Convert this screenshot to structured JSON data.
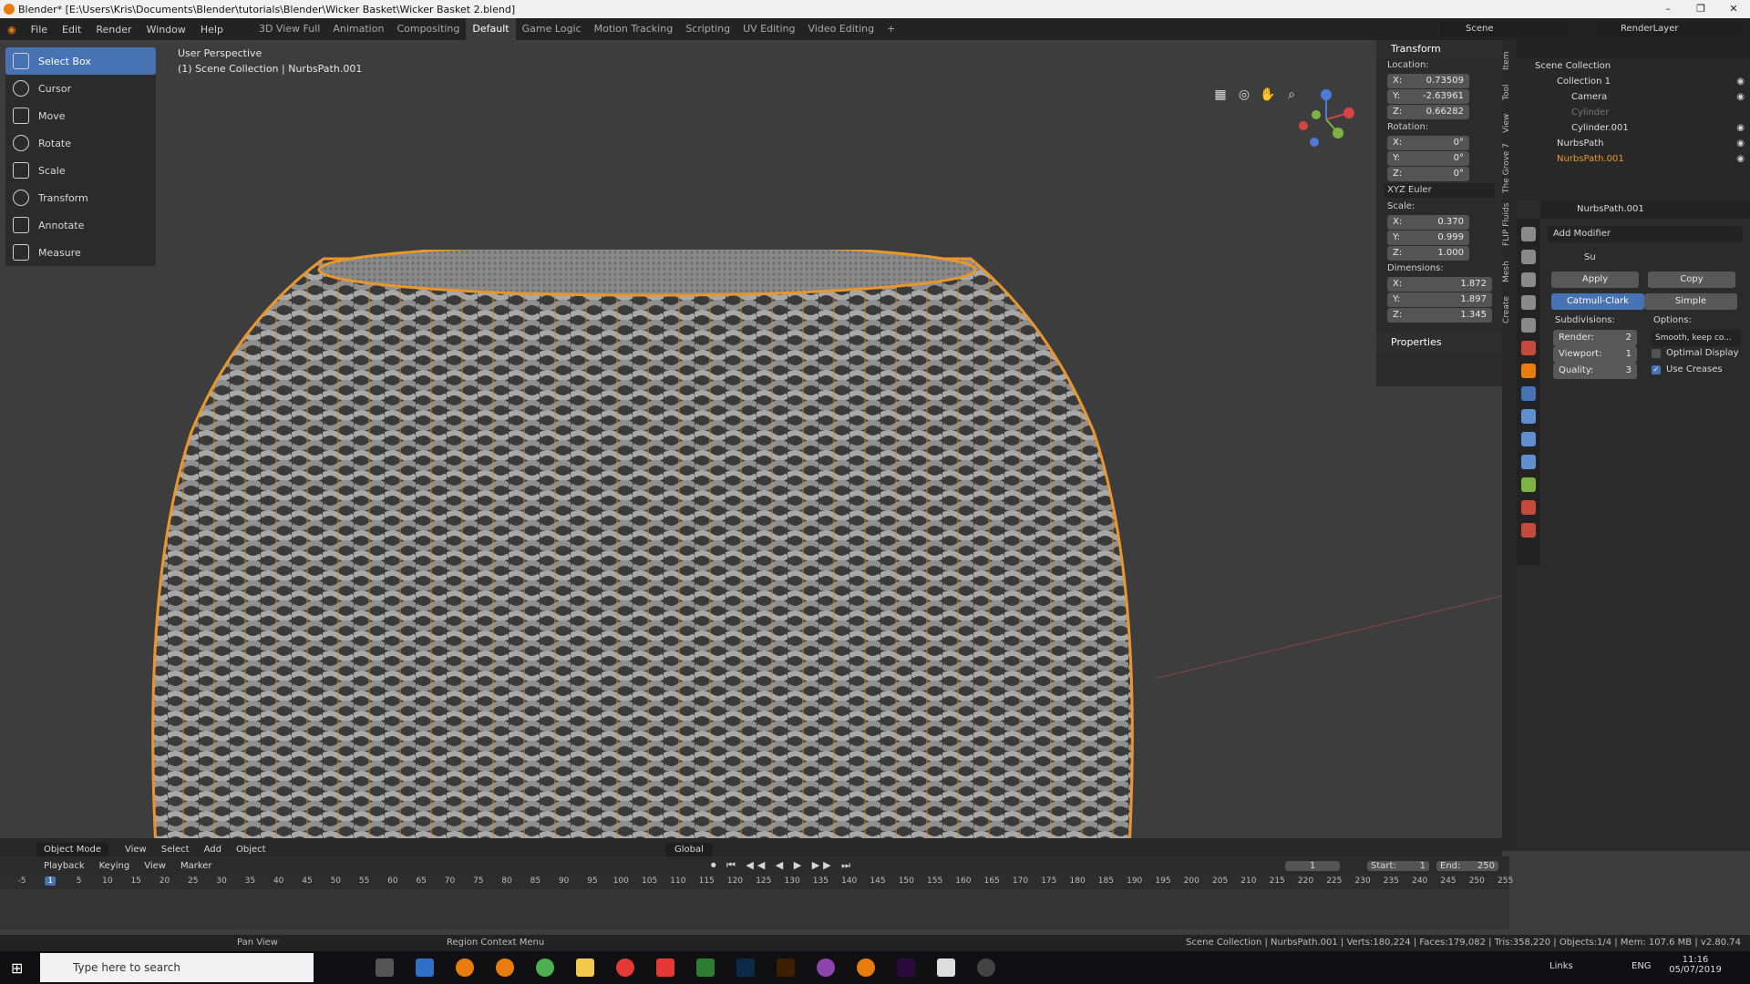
{
  "window": {
    "title": "Blender* [E:\\Users\\Kris\\Documents\\Blender\\tutorials\\Blender\\Wicker Basket\\Wicker Basket 2.blend]",
    "controls": [
      "–",
      "❐",
      "✕"
    ]
  },
  "menu": [
    "File",
    "Edit",
    "Render",
    "Window",
    "Help"
  ],
  "workspaces": [
    "3D View Full",
    "Animation",
    "Compositing",
    "Default",
    "Game Logic",
    "Motion Tracking",
    "Scripting",
    "UV Editing",
    "Video Editing",
    "+"
  ],
  "active_workspace": "Default",
  "scene_label": "Scene",
  "renderlayer_label": "RenderLayer",
  "tools": [
    {
      "label": "Select Box",
      "icon": "select-box-icon",
      "active": true
    },
    {
      "label": "Cursor",
      "icon": "cursor-icon"
    },
    {
      "label": "Move",
      "icon": "move-icon"
    },
    {
      "label": "Rotate",
      "icon": "rotate-icon"
    },
    {
      "label": "Scale",
      "icon": "scale-icon"
    },
    {
      "label": "Transform",
      "icon": "transform-icon"
    },
    {
      "label": "Annotate",
      "icon": "annotate-icon"
    },
    {
      "label": "Measure",
      "icon": "measure-icon"
    }
  ],
  "viewport": {
    "perspective": "User Perspective",
    "collection_info": "(1) Scene Collection | NurbsPath.001"
  },
  "npanel": {
    "transform_header": "Transform",
    "location_label": "Location:",
    "location": [
      {
        "axis": "X:",
        "value": "0.73509"
      },
      {
        "axis": "Y:",
        "value": "-2.63961"
      },
      {
        "axis": "Z:",
        "value": "0.66282"
      }
    ],
    "rotation_label": "Rotation:",
    "rotation": [
      {
        "axis": "X:",
        "value": "0°"
      },
      {
        "axis": "Y:",
        "value": "0°"
      },
      {
        "axis": "Z:",
        "value": "0°"
      }
    ],
    "rotation_mode": "XYZ Euler",
    "scale_label": "Scale:",
    "scale": [
      {
        "axis": "X:",
        "value": "0.370"
      },
      {
        "axis": "Y:",
        "value": "0.999"
      },
      {
        "axis": "Z:",
        "value": "1.000"
      }
    ],
    "dimensions_label": "Dimensions:",
    "dimensions": [
      {
        "axis": "X:",
        "value": "1.872"
      },
      {
        "axis": "Y:",
        "value": "1.897"
      },
      {
        "axis": "Z:",
        "value": "1.345"
      }
    ],
    "properties_header": "Properties"
  },
  "sidetabs": [
    "Item",
    "Tool",
    "View",
    "The Grove 7",
    "FLIP Fluids",
    "Mesh",
    "Create"
  ],
  "outliner": {
    "root": "Scene Collection",
    "items": [
      {
        "label": "Collection 1",
        "indent": 1
      },
      {
        "label": "Camera",
        "indent": 2
      },
      {
        "label": "Cylinder",
        "indent": 2,
        "dim": true
      },
      {
        "label": "Cylinder.001",
        "indent": 2
      },
      {
        "label": "NurbsPath",
        "indent": 1
      },
      {
        "label": "NurbsPath.001",
        "indent": 1,
        "selected": true
      }
    ]
  },
  "properties": {
    "object_name": "NurbsPath.001",
    "add_modifier": "Add Modifier",
    "modifier_name": "Su",
    "apply": "Apply",
    "copy": "Copy",
    "catmull": "Catmull-Clark",
    "simple": "Simple",
    "subdivisions_label": "Subdivisions:",
    "options_label": "Options:",
    "render_label": "Render:",
    "render_value": "2",
    "viewport_label": "Viewport:",
    "viewport_value": "1",
    "quality_label": "Quality:",
    "quality_value": "3",
    "uv_option": "Smooth, keep co...",
    "optimal_display": "Optimal Display",
    "use_creases": "Use Creases"
  },
  "header3d": {
    "mode": "Object Mode",
    "menus": [
      "View",
      "Select",
      "Add",
      "Object"
    ],
    "orientation": "Global"
  },
  "timeline": {
    "menus": [
      "Playback",
      "Keying",
      "View",
      "Marker"
    ],
    "current_frame": "1",
    "start_label": "Start:",
    "start": "1",
    "end_label": "End:",
    "end": "250",
    "ruler": [
      "-5",
      "1",
      "5",
      "10",
      "15",
      "20",
      "25",
      "30",
      "35",
      "40",
      "45",
      "50",
      "55",
      "60",
      "65",
      "70",
      "75",
      "80",
      "85",
      "90",
      "95",
      "100",
      "105",
      "110",
      "115",
      "120",
      "125",
      "130",
      "135",
      "140",
      "145",
      "150",
      "155",
      "160",
      "165",
      "170",
      "175",
      "180",
      "185",
      "190",
      "195",
      "200",
      "205",
      "210",
      "215",
      "220",
      "225",
      "230",
      "235",
      "240",
      "245",
      "250",
      "255"
    ]
  },
  "status": {
    "pan": "Pan View",
    "context": "Region Context Menu",
    "stats": "Scene Collection | NurbsPath.001 | Verts:180,224 | Faces:179,082 | Tris:358,220 | Objects:1/4 | Mem: 107.6 MB | v2.80.74"
  },
  "taskbar": {
    "search": "Type here to search",
    "links": "Links",
    "lang": "ENG",
    "time": "11:16",
    "date": "05/07/2019"
  },
  "colors": {
    "accent": "#4772b3",
    "wicker": "#9a9a9a",
    "outline": "#e8972c"
  }
}
